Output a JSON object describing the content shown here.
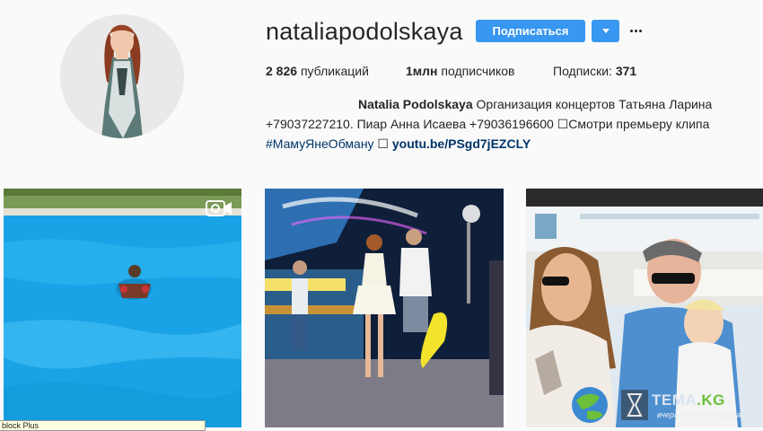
{
  "profile": {
    "username": "nataliapodolskaya",
    "follow_label": "Подписаться",
    "more_label": "···",
    "stats": {
      "posts_count": "2 826",
      "posts_label": "публикаций",
      "followers_count": "1млн",
      "followers_label": "подписчиков",
      "following_label": "Подписки:",
      "following_count": "371"
    },
    "bio": {
      "name": "Natalia Podolskaya",
      "line1": " Организация концертов Татьяна Ларина",
      "line2": "+79037227210. Пиар Анна Исаева +79036196600 ☐Смотри премьеру клипа",
      "hashtag": "#МамуЯнеОбману",
      "box_glyph": " ☐ ",
      "link": "youtu.be/PSgd7jEZCLY"
    }
  },
  "overlay": {
    "extension_tip": "block Plus",
    "watermark_title_a": "TEMA",
    "watermark_title_b": ".KG",
    "watermark_sub": "вчера сегодня завтра"
  },
  "colors": {
    "follow_button": "#3897f0",
    "link": "#003569",
    "background": "#fafafa"
  }
}
